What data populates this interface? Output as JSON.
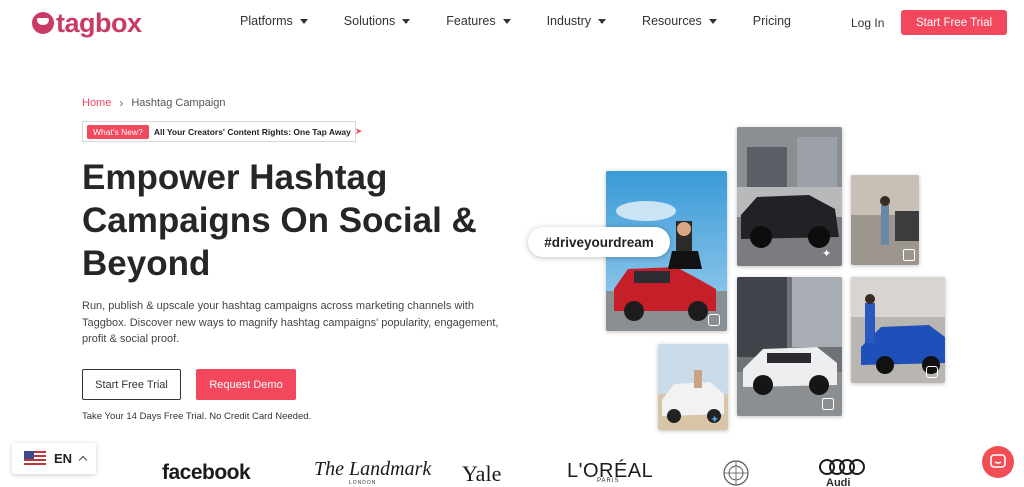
{
  "brand": {
    "name": "tagbox",
    "color": "#c93a64"
  },
  "nav": {
    "items": [
      {
        "label": "Platforms",
        "has_dropdown": true
      },
      {
        "label": "Solutions",
        "has_dropdown": true
      },
      {
        "label": "Features",
        "has_dropdown": true
      },
      {
        "label": "Industry",
        "has_dropdown": true
      },
      {
        "label": "Resources",
        "has_dropdown": true
      },
      {
        "label": "Pricing",
        "has_dropdown": false
      }
    ],
    "login": "Log In",
    "cta": "Start Free Trial"
  },
  "breadcrumb": {
    "home": "Home",
    "current": "Hashtag Campaign"
  },
  "announcement": {
    "badge": "What's New?",
    "text": "All Your Creators' Content Rights: One Tap Away",
    "icon": "rocket-icon"
  },
  "hero": {
    "headline_line1": "Empower Hashtag",
    "headline_line2": "Campaigns On Social &",
    "headline_line3": "Beyond",
    "subtext": "Run, publish & upscale your hashtag campaigns across marketing channels with Taggbox. Discover new ways to magnify hashtag campaigns' popularity, engagement, profit & social proof.",
    "primary_button": "Start Free Trial",
    "secondary_button": "Request Demo",
    "note": "Take Your 14 Days Free Trial. No Credit Card Needed.",
    "hashtag": "#driveyourdream"
  },
  "collage": {
    "tiles": [
      {
        "name": "red-car-tile",
        "platform": "instagram-icon"
      },
      {
        "name": "black-audi-tile",
        "platform": "twitter-icon"
      },
      {
        "name": "street-woman-tile",
        "platform": "media-icon"
      },
      {
        "name": "white-sportscar-tile",
        "platform": "media-icon"
      },
      {
        "name": "blue-car-tile",
        "platform": "instagram-icon"
      },
      {
        "name": "beach-car-tile",
        "platform": "twitter-icon"
      }
    ]
  },
  "logos": {
    "facebook": "facebook",
    "landmark": "The Landmark",
    "landmark_sub": "LONDON",
    "yale": "Yale",
    "loreal": "L'ORÉAL",
    "loreal_sub": "PARIS",
    "un": "un-emblem-icon",
    "audi": "Audi"
  },
  "language": {
    "label": "EN",
    "flag": "us-flag-icon"
  },
  "chat": {
    "icon": "chat-icon"
  },
  "colors": {
    "accent": "#f3475e",
    "text": "#262626"
  }
}
